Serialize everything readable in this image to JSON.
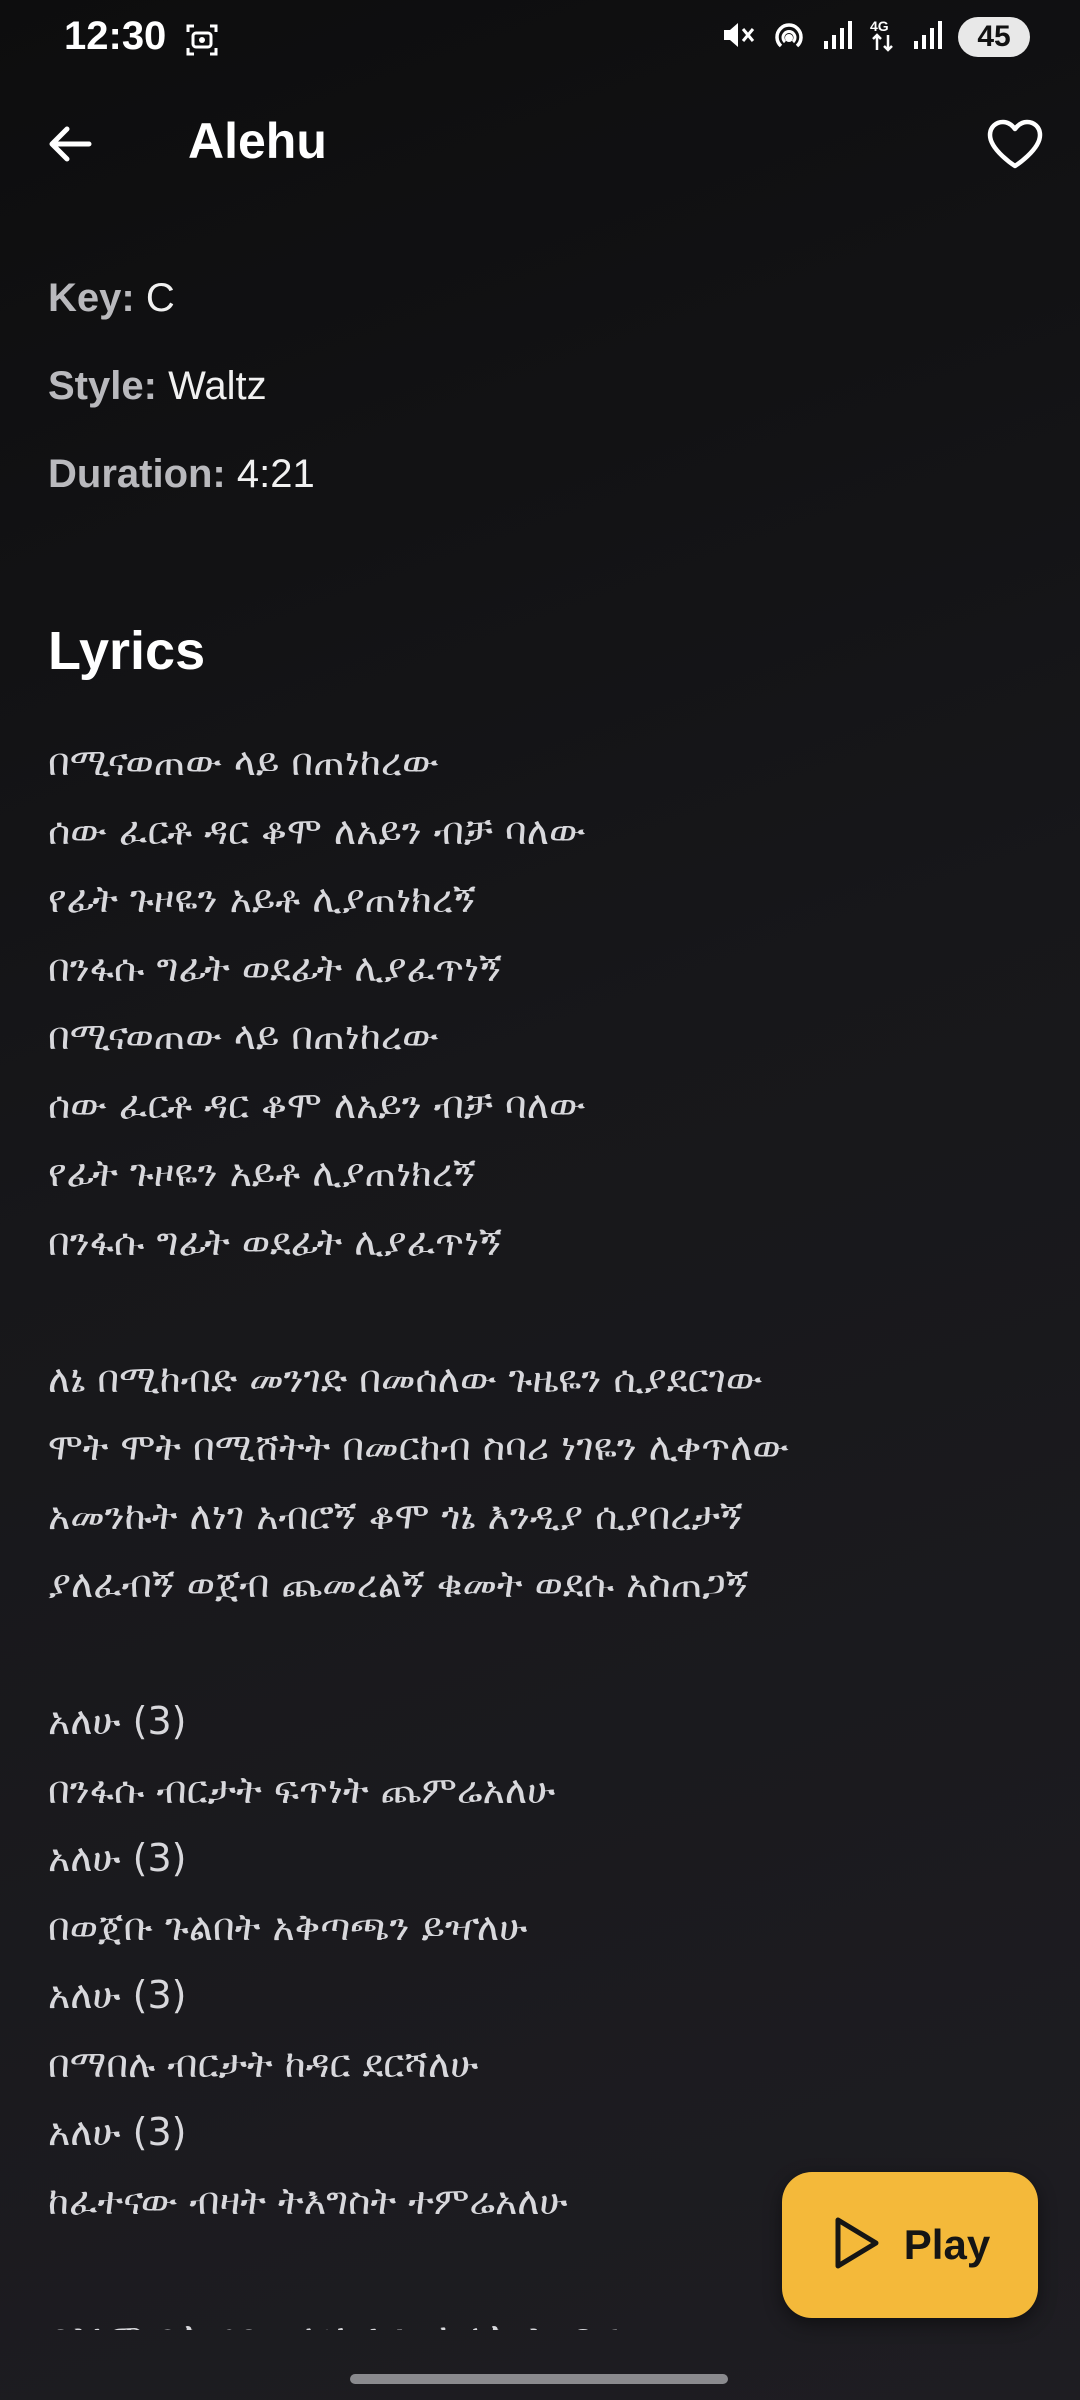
{
  "status_bar": {
    "time": "12:30",
    "battery": "45",
    "icons": [
      "screen-record-icon",
      "mute-icon",
      "hotspot-icon",
      "signal-icon",
      "4g-icon",
      "signal-icon",
      "battery-icon"
    ]
  },
  "app_bar": {
    "title": "Alehu",
    "icons": [
      "back-arrow-icon",
      "heart-icon"
    ]
  },
  "song_meta": {
    "key_label": "Key:",
    "key_value": "C",
    "style_label": "Style:",
    "style_value": "Waltz",
    "duration_label": "Duration:",
    "duration_value": "4:21"
  },
  "lyrics": {
    "heading": "Lyrics",
    "lines": [
      "በሚናወጠው ላይ በጠነከረው",
      "ሰው ፈርቶ ዳር ቆሞ ለአይን ብቻ ባለው",
      "የፊት ጉዞዬን አይቶ ሊያጠነክረኝ",
      "በንፋሱ ግፊት ወደፊት ሊያፈጥነኝ",
      "በሚናወጠው ላይ በጠነከረው",
      "ሰው ፈርቶ ዳር ቆሞ ለአይን ብቻ ባለው",
      "የፊት ጉዞዬን አይቶ ሊያጠነክረኝ",
      "በንፋሱ ግፊት ወደፊት ሊያፈጥነኝ",
      "",
      "ለኔ በሚከብድ መንገድ በመሰለው ጉዜዬን ሲያደርገው",
      "ሞት ሞት በሚሸትት በመርከብ ስባሪ ነገዬን ሊቀጥለው",
      "አመንኩት ለነገ አብሮኝ ቆሞ ጎኔ እንዲያ ሲያበረታኝ",
      "ያለፈብኝ ወጀብ ጨመረልኝ ቁመት ወደሱ አስጠጋኝ",
      "",
      "አለሁ (3)",
      "በንፋሱ ብርታት ፍጥነት ጨምሬአለሁ",
      "አለሁ (3)",
      "በወጀቡ ጉልበት አቅጣጫን ይዣለሁ",
      "አለሁ (3)",
      "በማበሉ ብርታት ከዳር ደርሻለሁ",
      "አለሁ (3)",
      "ከፈተናው ብዛት ትእግስት ተምሬአለሁ",
      "",
      "በእኔም ቤት ገባ ቃልህ ፈቀዮኩለት እንዳ ሰራ"
    ]
  },
  "play_button": {
    "label": "Play",
    "icon": "play-icon",
    "color": "#f4b93a"
  }
}
